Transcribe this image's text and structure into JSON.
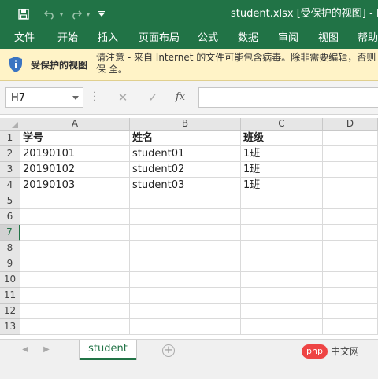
{
  "titlebar": {
    "title": "student.xlsx  [受保护的视图]  -  Ex",
    "colors": {
      "accent": "#217346"
    },
    "icons": [
      "save-icon",
      "undo-icon",
      "redo-icon",
      "customize-quick-access-icon"
    ]
  },
  "ribbon": {
    "tabs": [
      "文件",
      "开始",
      "插入",
      "页面布局",
      "公式",
      "数据",
      "审阅",
      "视图",
      "帮助"
    ]
  },
  "protected_view": {
    "title": "受保护的视图",
    "message": "请注意 - 来自 Internet 的文件可能包含病毒。除非需要编辑，否则保持在受保护的视图中比较安全。",
    "message_visible": "请注意 - 来自 Internet 的文件可能包含病毒。除非需要编辑，否则保 全。",
    "background": "#fff3c7"
  },
  "formula_bar": {
    "name_box": "H7",
    "cancel_icon": "✕",
    "enter_icon": "✓",
    "fx_label": "fx",
    "formula": ""
  },
  "sheet": {
    "columns": [
      "A",
      "B",
      "C",
      "D"
    ],
    "rows": [
      "1",
      "2",
      "3",
      "4",
      "5",
      "6",
      "7",
      "8",
      "9",
      "10",
      "11",
      "12",
      "13"
    ],
    "active_row": "7",
    "data": [
      [
        "学号",
        "姓名",
        "班级"
      ],
      [
        "20190101",
        "student01",
        "1班"
      ],
      [
        "20190102",
        "student02",
        "1班"
      ],
      [
        "20190103",
        "student03",
        "1班"
      ]
    ]
  },
  "sheet_tabs": {
    "active": "student",
    "add_label": "+"
  },
  "watermark": {
    "logo": "php",
    "text": "中文网"
  }
}
